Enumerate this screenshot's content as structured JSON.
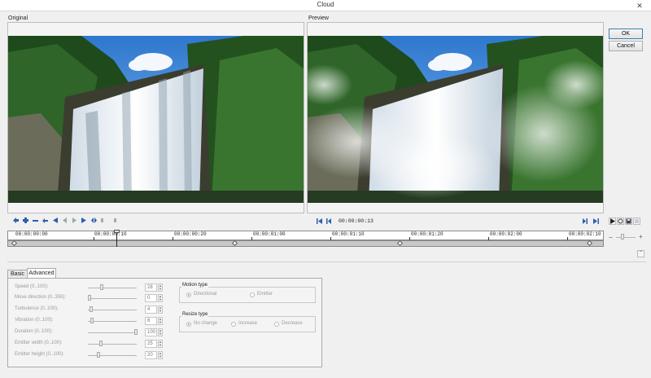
{
  "window": {
    "title": "Cloud"
  },
  "panes": {
    "original_label": "Original",
    "preview_label": "Preview"
  },
  "buttons": {
    "ok": "OK",
    "cancel": "Cancel"
  },
  "transport": {
    "timecode": "00:00:00:13"
  },
  "timeline": {
    "ticks": [
      "00:00:00:00",
      "00:00:00:10",
      "00:00:00:20",
      "00:00:01:00",
      "00:00:01:10",
      "00:00:01:20",
      "00:00:02:00",
      "00:00:02:10"
    ]
  },
  "tabs": [
    {
      "label": "Basic"
    },
    {
      "label": "Advanced"
    }
  ],
  "params": [
    {
      "label": "Speed (0..100):",
      "value": "28"
    },
    {
      "label": "Move direction (0..359):",
      "value": "0"
    },
    {
      "label": "Turbulence (0..100):",
      "value": "4"
    },
    {
      "label": "Vibration (0..100):",
      "value": "6"
    },
    {
      "label": "Duration (0..100):",
      "value": "100"
    },
    {
      "label": "Emitter width (0..100):",
      "value": "25"
    },
    {
      "label": "Emitter height (0..100):",
      "value": "20"
    }
  ],
  "motion_type": {
    "title": "Motion type",
    "options": [
      "Directional",
      "Emitter"
    ]
  },
  "resize_type": {
    "title": "Resize type",
    "options": [
      "No change",
      "Increase",
      "Decrease"
    ]
  },
  "colors": {
    "accent": "#3c7fb1",
    "sky": "#5aa0e0"
  }
}
